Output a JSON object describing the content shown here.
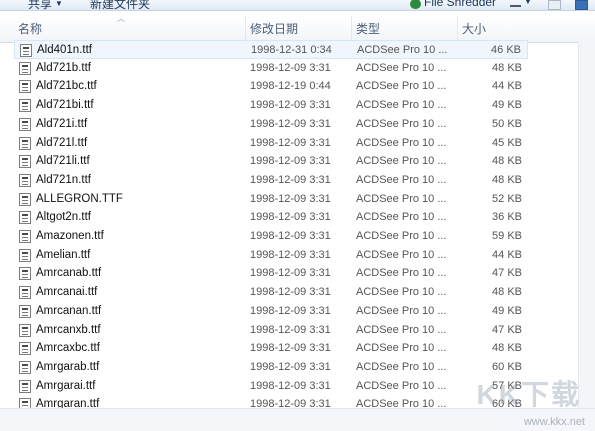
{
  "toolbar": {
    "share_label": "共享",
    "new_folder_label": "新建文件夹",
    "shredder_label": "File Shredder",
    "view_icon": "view-list-icon"
  },
  "columns": {
    "name": "名称",
    "modified": "修改日期",
    "type": "类型",
    "size": "大小"
  },
  "files": [
    {
      "name": "Ald401n.ttf",
      "date": "1998-12-31 0:34",
      "type": "ACDSee Pro 10 ...",
      "size": "46 KB"
    },
    {
      "name": "Ald721b.ttf",
      "date": "1998-12-09 3:31",
      "type": "ACDSee Pro 10 ...",
      "size": "48 KB"
    },
    {
      "name": "Ald721bc.ttf",
      "date": "1998-12-19 0:44",
      "type": "ACDSee Pro 10 ...",
      "size": "44 KB"
    },
    {
      "name": "Ald721bi.ttf",
      "date": "1998-12-09 3:31",
      "type": "ACDSee Pro 10 ...",
      "size": "49 KB"
    },
    {
      "name": "Ald721i.ttf",
      "date": "1998-12-09 3:31",
      "type": "ACDSee Pro 10 ...",
      "size": "50 KB"
    },
    {
      "name": "Ald721l.ttf",
      "date": "1998-12-09 3:31",
      "type": "ACDSee Pro 10 ...",
      "size": "45 KB"
    },
    {
      "name": "Ald721li.ttf",
      "date": "1998-12-09 3:31",
      "type": "ACDSee Pro 10 ...",
      "size": "48 KB"
    },
    {
      "name": "Ald721n.ttf",
      "date": "1998-12-09 3:31",
      "type": "ACDSee Pro 10 ...",
      "size": "48 KB"
    },
    {
      "name": "ALLEGRON.TTF",
      "date": "1998-12-09 3:31",
      "type": "ACDSee Pro 10 ...",
      "size": "52 KB"
    },
    {
      "name": "Altgot2n.ttf",
      "date": "1998-12-09 3:31",
      "type": "ACDSee Pro 10 ...",
      "size": "36 KB"
    },
    {
      "name": "Amazonen.ttf",
      "date": "1998-12-09 3:31",
      "type": "ACDSee Pro 10 ...",
      "size": "59 KB"
    },
    {
      "name": "Amelian.ttf",
      "date": "1998-12-09 3:31",
      "type": "ACDSee Pro 10 ...",
      "size": "44 KB"
    },
    {
      "name": "Amrcanab.ttf",
      "date": "1998-12-09 3:31",
      "type": "ACDSee Pro 10 ...",
      "size": "47 KB"
    },
    {
      "name": "Amrcanai.ttf",
      "date": "1998-12-09 3:31",
      "type": "ACDSee Pro 10 ...",
      "size": "48 KB"
    },
    {
      "name": "Amrcanan.ttf",
      "date": "1998-12-09 3:31",
      "type": "ACDSee Pro 10 ...",
      "size": "49 KB"
    },
    {
      "name": "Amrcanxb.ttf",
      "date": "1998-12-09 3:31",
      "type": "ACDSee Pro 10 ...",
      "size": "47 KB"
    },
    {
      "name": "Amrcaxbc.ttf",
      "date": "1998-12-09 3:31",
      "type": "ACDSee Pro 10 ...",
      "size": "48 KB"
    },
    {
      "name": "Amrgarab.ttf",
      "date": "1998-12-09 3:31",
      "type": "ACDSee Pro 10 ...",
      "size": "60 KB"
    },
    {
      "name": "Amrgarai.ttf",
      "date": "1998-12-09 3:31",
      "type": "ACDSee Pro 10 ...",
      "size": "57 KB"
    },
    {
      "name": "Amrgaran.ttf",
      "date": "1998-12-09 3:31",
      "type": "ACDSee Pro 10 ...",
      "size": "60 KB"
    }
  ],
  "watermark": {
    "logo_text": "KK下载",
    "url": "www.kkx.net"
  },
  "colors": {
    "selection": "#f0f6fd",
    "header_text": "#4c607a"
  }
}
